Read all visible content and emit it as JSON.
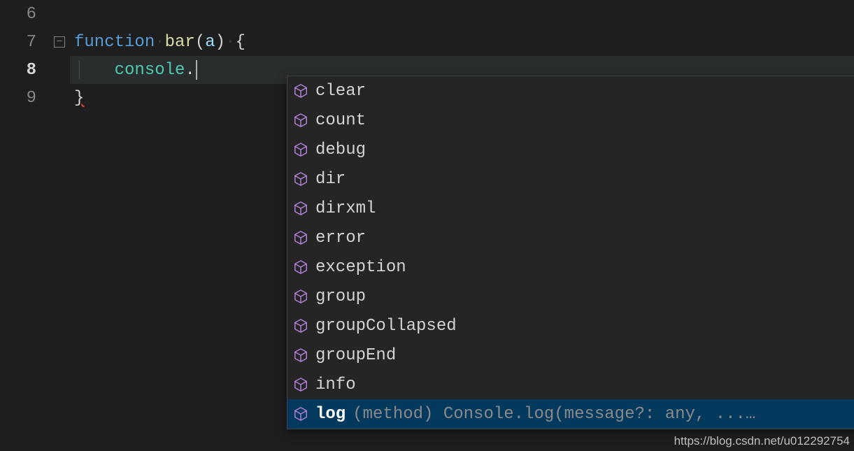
{
  "gutter": {
    "lines": [
      "6",
      "7",
      "8",
      "9"
    ],
    "current_index": 2
  },
  "code": {
    "line7": {
      "kw": "function",
      "fn": "bar",
      "params": "a",
      "open": "(",
      "close": ")",
      "brace": "{",
      "space_dot": "·"
    },
    "line8": {
      "obj": "console",
      "dot": "."
    },
    "line9": {
      "brace": "}"
    }
  },
  "suggestions": {
    "items": [
      {
        "label": "clear"
      },
      {
        "label": "count"
      },
      {
        "label": "debug"
      },
      {
        "label": "dir"
      },
      {
        "label": "dirxml"
      },
      {
        "label": "error"
      },
      {
        "label": "exception"
      },
      {
        "label": "group"
      },
      {
        "label": "groupCollapsed"
      },
      {
        "label": "groupEnd"
      },
      {
        "label": "info"
      },
      {
        "label": "log",
        "detail": "(method) Console.log(message?: any, ...…",
        "selected": true
      }
    ]
  },
  "watermark": "https://blog.csdn.net/u012292754"
}
